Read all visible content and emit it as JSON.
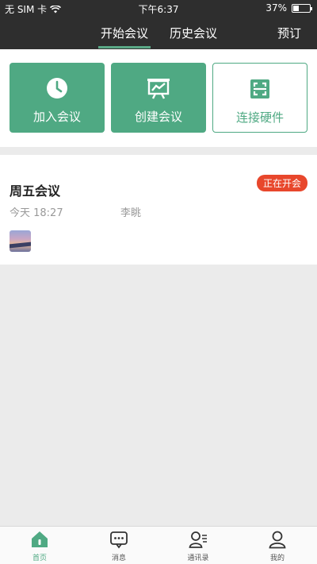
{
  "status_bar": {
    "carrier": "无 SIM 卡",
    "time": "下午6:37",
    "battery_percent": "37%",
    "battery_level": 0.37
  },
  "nav": {
    "tabs": [
      {
        "label": "开始会议",
        "active": true
      },
      {
        "label": "历史会议",
        "active": false
      }
    ],
    "reserve_label": "预订"
  },
  "actions": [
    {
      "label": "加入会议",
      "icon": "clock-icon"
    },
    {
      "label": "创建会议",
      "icon": "presentation-chart-icon"
    },
    {
      "label": "连接硬件",
      "icon": "scan-icon"
    }
  ],
  "meeting": {
    "title": "周五会议",
    "status": "正在开会",
    "time": "今天 18:27",
    "host": "李眺"
  },
  "bottom_tabs": [
    {
      "label": "首页",
      "icon": "home-icon",
      "active": true
    },
    {
      "label": "消息",
      "icon": "chat-icon",
      "active": false
    },
    {
      "label": "通讯录",
      "icon": "contacts-icon",
      "active": false
    },
    {
      "label": "我的",
      "icon": "profile-icon",
      "active": false
    }
  ],
  "colors": {
    "accent": "#4fa983",
    "header": "#2e2e2e",
    "badge": "#e8472c"
  }
}
